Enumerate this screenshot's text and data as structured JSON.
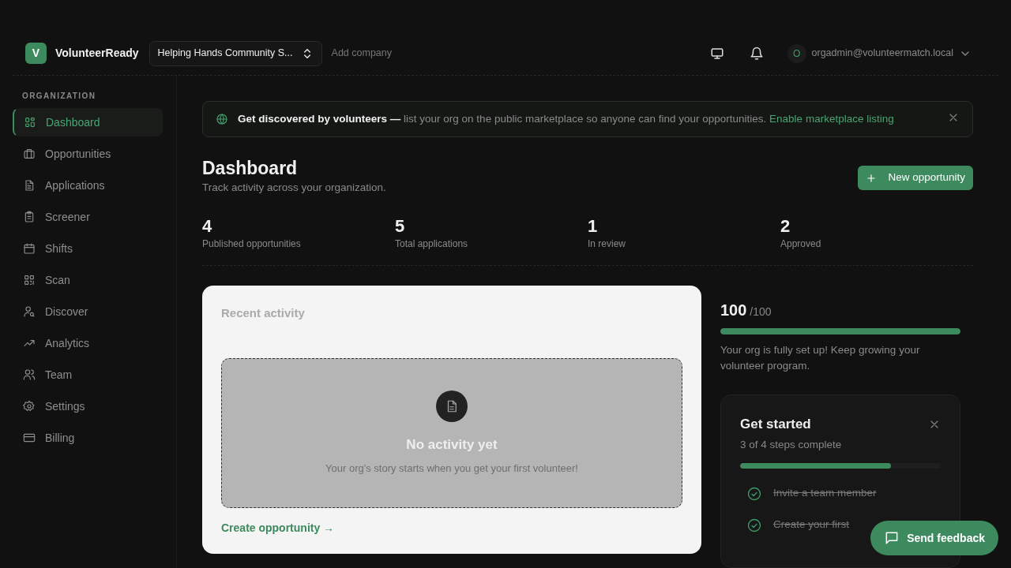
{
  "header": {
    "logo_letter": "V",
    "brand": "VolunteerReady",
    "org_selector": "Helping Hands Community S...",
    "add_company": "Add company",
    "user_initial": "O",
    "user_email": "orgadmin@volunteermatch.local"
  },
  "sidebar": {
    "section": "ORGANIZATION",
    "items": [
      {
        "label": "Dashboard",
        "selected": true
      },
      {
        "label": "Opportunities",
        "selected": false
      },
      {
        "label": "Applications",
        "selected": false
      },
      {
        "label": "Screener",
        "selected": false
      },
      {
        "label": "Shifts",
        "selected": false
      },
      {
        "label": "Scan",
        "selected": false
      },
      {
        "label": "Discover",
        "selected": false
      },
      {
        "label": "Analytics",
        "selected": false
      },
      {
        "label": "Team",
        "selected": false
      },
      {
        "label": "Settings",
        "selected": false
      },
      {
        "label": "Billing",
        "selected": false
      }
    ]
  },
  "banner": {
    "text": "**Get discovered by volunteers —** list your org on the public marketplace so anyone can find your opportunities.",
    "link": "Enable marketplace listing"
  },
  "page": {
    "title": "Dashboard",
    "subtitle": "Track activity across your organization.",
    "action": "New opportunity"
  },
  "stats": [
    {
      "value": "4",
      "label": "Published opportunities"
    },
    {
      "value": "5",
      "label": "Total applications"
    },
    {
      "value": "1",
      "label": "In review"
    },
    {
      "value": "2",
      "label": "Approved"
    }
  ],
  "recent_activity": {
    "title": "Recent activity",
    "empty_title": "No activity yet",
    "empty_text": "Your org's story starts when you get your first volunteer!",
    "link": "Create opportunity →"
  },
  "score": {
    "value": "100",
    "max": "/100",
    "level": 1.0,
    "message": "Your org is fully set up! Keep growing your volunteer program."
  },
  "get_started": {
    "title": "Get started",
    "progress_text": "3 of 4 steps complete",
    "level": 0.75,
    "steps": [
      {
        "label": "Invite a team member",
        "done": true
      },
      {
        "label": "Create your first",
        "done": true
      }
    ]
  },
  "feedback_button": "Send feedback"
}
